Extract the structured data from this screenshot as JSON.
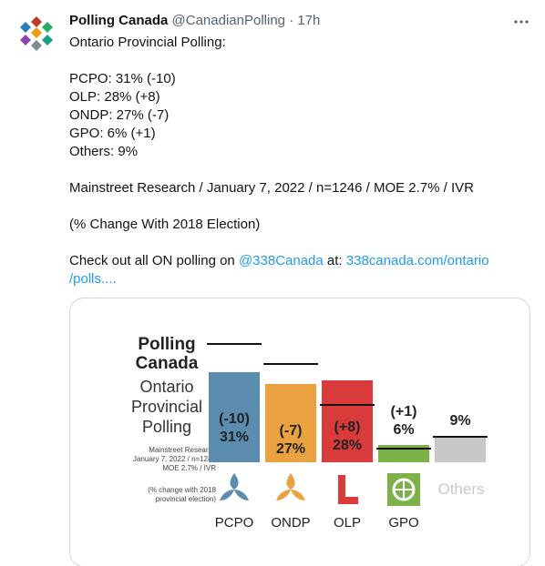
{
  "tweet": {
    "display_name": "Polling Canada",
    "handle": "@CanadianPolling",
    "separator": "·",
    "time": "17h",
    "lines": {
      "l1": "Ontario Provincial Polling:",
      "l2": "PCPO: 31% (-10)",
      "l3": "OLP: 28% (+8)",
      "l4": "ONDP: 27% (-7)",
      "l5": "GPO: 6% (+1)",
      "l6": "Others: 9%",
      "l7": "Mainstreet Research / January 7, 2022 / n=1246 / MOE 2.7% / IVR",
      "l8": "(% Change With 2018 Election)",
      "l9_pre": "Check out all ON polling on ",
      "l9_mention": "@338Canada",
      "l9_mid": " at: ",
      "l9_link_a": "338canada.com/ontario",
      "l9_link_b": "/polls...."
    }
  },
  "card": {
    "title_line1": "Polling",
    "title_line2": "Canada",
    "sub_line1": "Ontario",
    "sub_line2": "Provincial",
    "sub_line3": "Polling",
    "meta_line1": "Mainstreet Research",
    "meta_line2": "January 7, 2022 / n=1246",
    "meta_line3": "MOE 2.7% / IVR",
    "note_line1": "(% change with 2018",
    "note_line2": "provincial election)",
    "others_text": "Others"
  },
  "chart_data": {
    "type": "bar",
    "categories": [
      "PCPO",
      "ONDP",
      "OLP",
      "GPO",
      "Others"
    ],
    "values": [
      31,
      27,
      28,
      6,
      9
    ],
    "change_labels": [
      "(-10)",
      "(-7)",
      "(+8)",
      "(+1)",
      ""
    ],
    "value_labels": [
      "31%",
      "27%",
      "28%",
      "6%",
      "9%"
    ],
    "previous_2018": [
      41,
      34,
      20,
      5,
      9
    ],
    "colors": [
      "#5c8db1",
      "#eaa241",
      "#d93a3a",
      "#7db24a",
      "#c8c8c8"
    ],
    "ylim": [
      0,
      45
    ]
  },
  "icons": {
    "avatar": "polling-canada-logo",
    "more": "more-dots-icon"
  }
}
